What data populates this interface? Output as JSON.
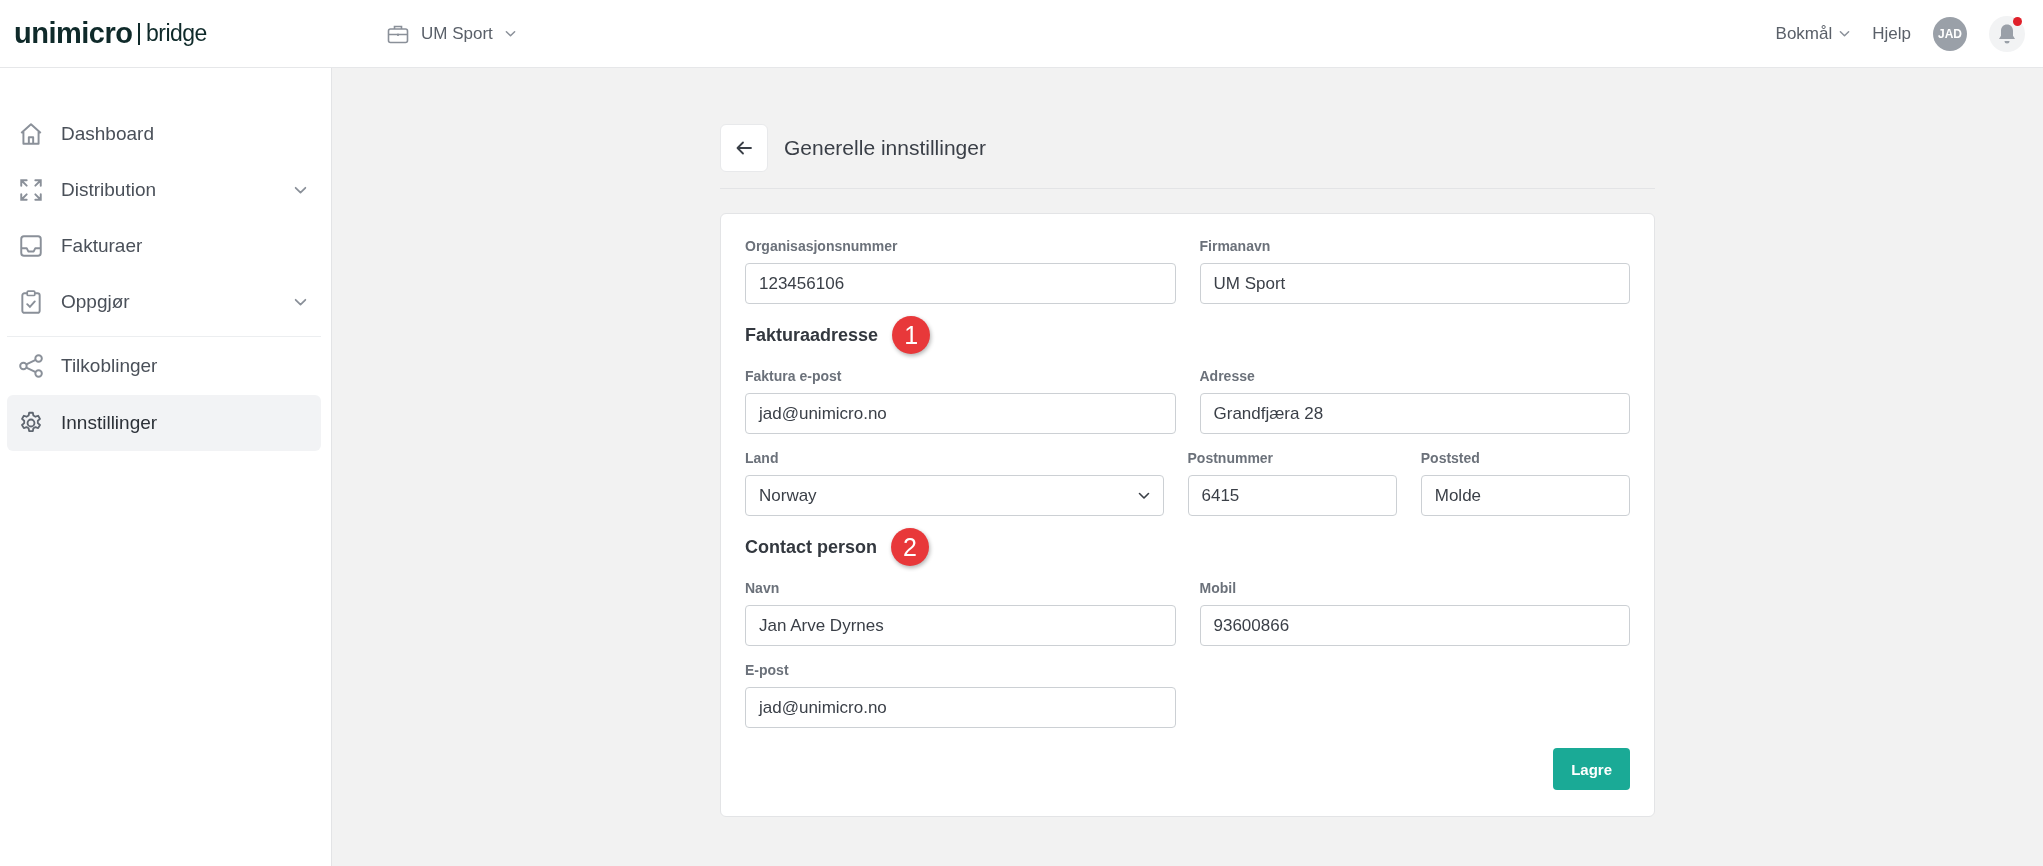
{
  "header": {
    "logo": {
      "brand": "unimicro",
      "product": "bridge"
    },
    "company": {
      "label": "UM Sport"
    },
    "language": {
      "label": "Bokmål"
    },
    "help": {
      "label": "Hjelp"
    },
    "avatar": {
      "initials": "JAD"
    },
    "notifications": {
      "unread": true
    }
  },
  "sidebar": {
    "items": [
      {
        "label": "Dashboard",
        "kind": "home",
        "expandable": false,
        "separated": false,
        "selected": false
      },
      {
        "label": "Distribution",
        "kind": "expand",
        "expandable": true,
        "separated": false,
        "selected": false
      },
      {
        "label": "Fakturaer",
        "kind": "inbox",
        "expandable": false,
        "separated": false,
        "selected": false
      },
      {
        "label": "Oppgjør",
        "kind": "clipboard",
        "expandable": true,
        "separated": false,
        "selected": false
      },
      {
        "label": "Tilkoblinger",
        "kind": "share",
        "expandable": false,
        "separated": true,
        "selected": false
      },
      {
        "label": "Innstillinger",
        "kind": "gear",
        "expandable": false,
        "separated": false,
        "selected": true
      }
    ]
  },
  "page": {
    "title": "Generelle innstillinger"
  },
  "form": {
    "blocks": [
      {
        "kind": "fields",
        "fields": [
          {
            "label": "Organisasjonsnummer",
            "value": "123456106",
            "kind": "text"
          },
          {
            "label": "Firmanavn",
            "value": "UM Sport",
            "kind": "text"
          }
        ]
      },
      {
        "kind": "heading",
        "text": "Fakturaadresse",
        "badge": "1"
      },
      {
        "kind": "fields",
        "fields": [
          {
            "label": "Faktura e-post",
            "value": "jad@unimicro.no",
            "kind": "text"
          },
          {
            "label": "Adresse",
            "value": "Grandfjæra 28",
            "kind": "text"
          }
        ]
      },
      {
        "kind": "fields",
        "fields": [
          {
            "label": "Land",
            "value": "Norway",
            "kind": "select"
          },
          {
            "label": "Postnummer",
            "value": "6415",
            "kind": "text"
          },
          {
            "label": "Poststed",
            "value": "Molde",
            "kind": "text"
          }
        ]
      },
      {
        "kind": "heading",
        "text": "Contact person",
        "badge": "2"
      },
      {
        "kind": "fields",
        "fields": [
          {
            "label": "Navn",
            "value": "Jan Arve Dyrnes",
            "kind": "text"
          },
          {
            "label": "Mobil",
            "value": "93600866",
            "kind": "text"
          }
        ]
      },
      {
        "kind": "fields",
        "fields": [
          {
            "label": "E-post",
            "value": "jad@unimicro.no",
            "kind": "text"
          }
        ]
      }
    ],
    "save_button": "Lagre"
  }
}
